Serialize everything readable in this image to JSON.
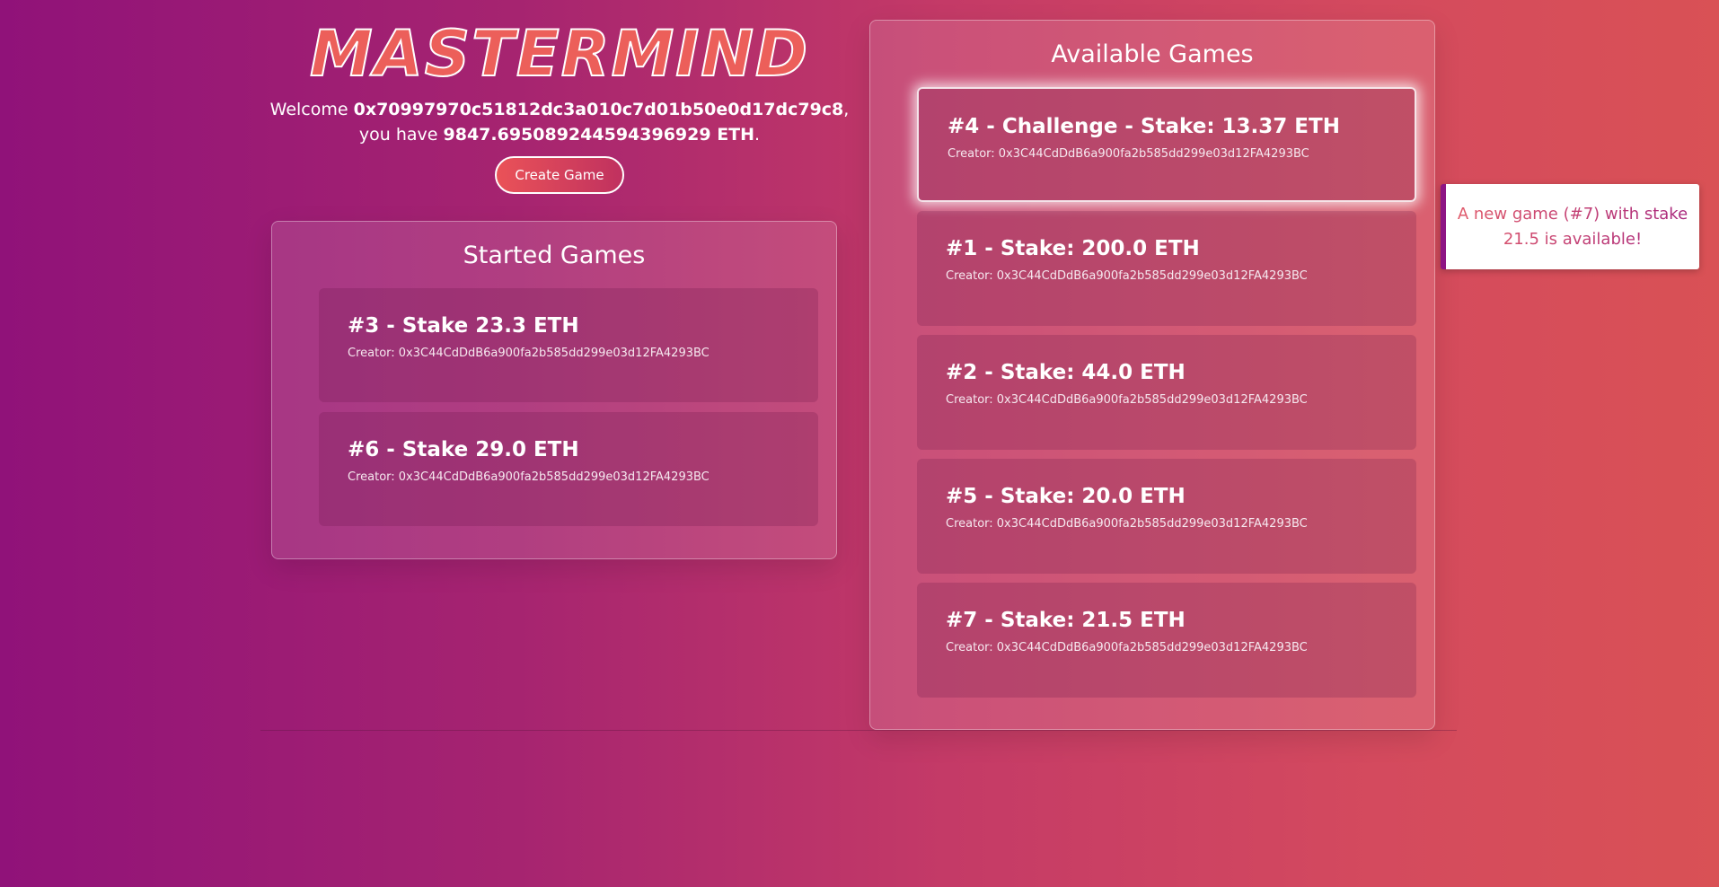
{
  "app": {
    "logo_text": "MASTERMIND",
    "welcome_prefix": "Welcome ",
    "address": "0x70997970c51812dc3a010c7d01b50e0d17dc79c8",
    "welcome_mid": ", you have ",
    "balance": "9847.695089244594396929 ETH",
    "welcome_suffix": ".",
    "create_button_label": "Create Game"
  },
  "started_games": {
    "title": "Started Games",
    "games": [
      {
        "title": "#3 - Stake 23.3 ETH",
        "creator": "Creator: 0x3C44CdDdB6a900fa2b585dd299e03d12FA4293BC"
      },
      {
        "title": "#6 - Stake 29.0 ETH",
        "creator": "Creator: 0x3C44CdDdB6a900fa2b585dd299e03d12FA4293BC"
      }
    ]
  },
  "available_games": {
    "title": "Available Games",
    "games": [
      {
        "title": "#4 - Challenge - Stake: 13.37 ETH",
        "creator": "Creator: 0x3C44CdDdB6a900fa2b585dd299e03d12FA4293BC"
      },
      {
        "title": "#1 - Stake: 200.0 ETH",
        "creator": "Creator: 0x3C44CdDdB6a900fa2b585dd299e03d12FA4293BC"
      },
      {
        "title": "#2 - Stake: 44.0 ETH",
        "creator": "Creator: 0x3C44CdDdB6a900fa2b585dd299e03d12FA4293BC"
      },
      {
        "title": "#5 - Stake: 20.0 ETH",
        "creator": "Creator: 0x3C44CdDdB6a900fa2b585dd299e03d12FA4293BC"
      },
      {
        "title": "#7 - Stake: 21.5 ETH",
        "creator": "Creator: 0x3C44CdDdB6a900fa2b585dd299e03d12FA4293BC"
      }
    ]
  },
  "toast": {
    "message": "A new game (#7) with stake 21.5 is available!"
  },
  "colors": {
    "background_start": "#901279",
    "background_end": "#d95155",
    "logo_fill": "#ec5f5a",
    "toast_accent": "#8e1584"
  }
}
